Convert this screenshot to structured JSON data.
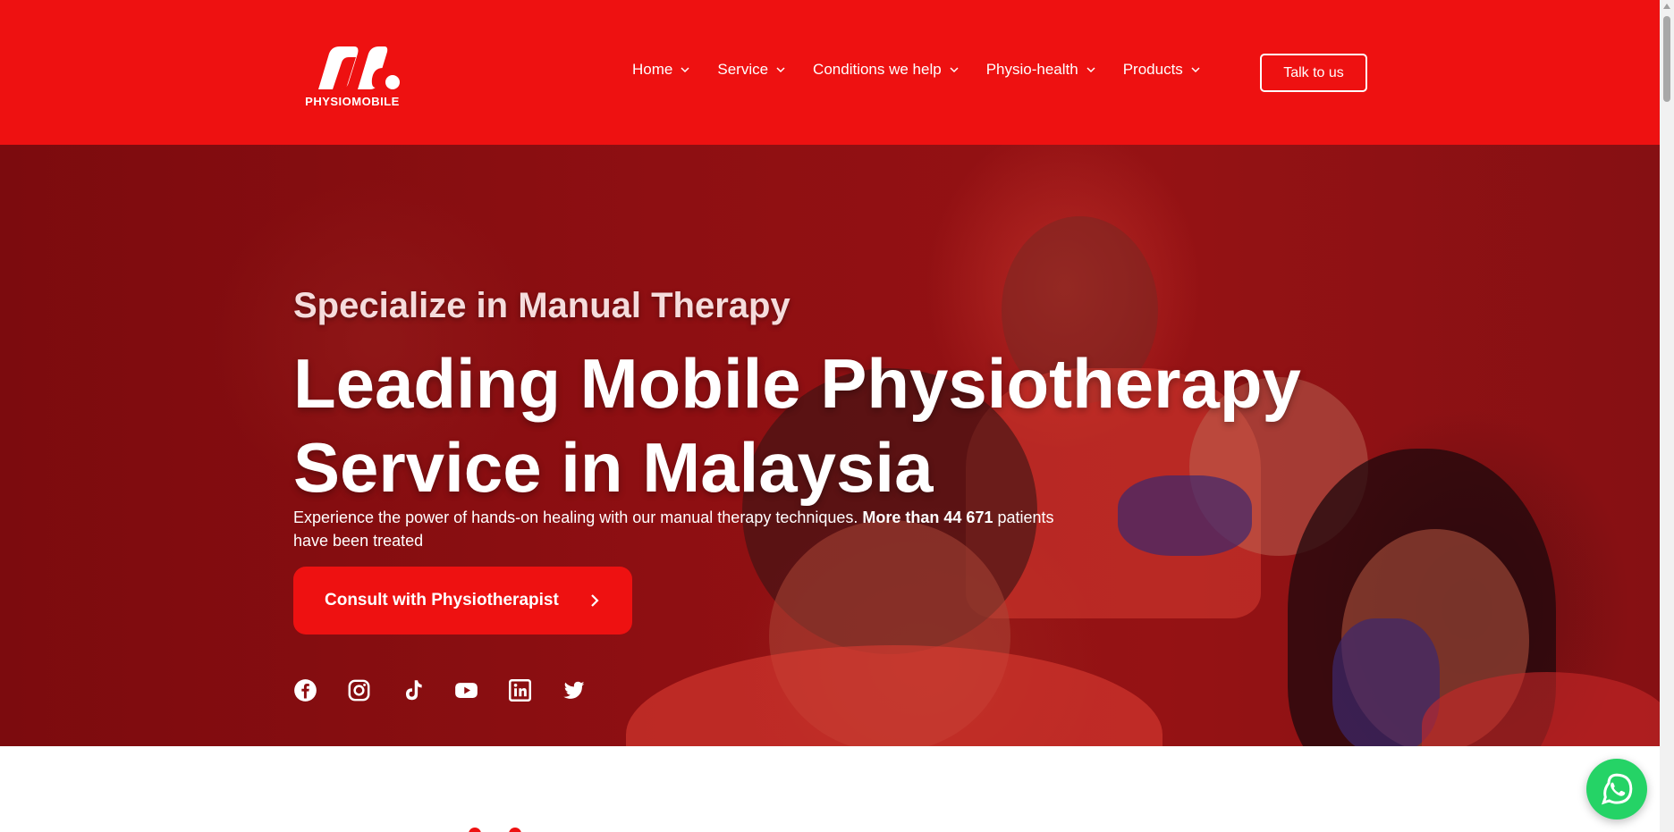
{
  "brand": {
    "name": "PHYSIOMOBILE",
    "color": "#ee1111"
  },
  "nav": {
    "items": [
      {
        "label": "Home"
      },
      {
        "label": "Service"
      },
      {
        "label": "Conditions we help"
      },
      {
        "label": "Physio-health"
      },
      {
        "label": "Products"
      }
    ],
    "cta_label": "Talk to us"
  },
  "hero": {
    "subtitle": "Specialize in Manual Therapy",
    "title": "Leading Mobile Physiotherapy Service in Malaysia",
    "description_text": "Experience the power of hands-on healing with our manual therapy techniques. ",
    "description_bold": "More than 44 671",
    "description_tail": " patients have been treated",
    "cta_label": "Consult with Physiotherapist",
    "socials": [
      "facebook-icon",
      "instagram-icon",
      "tiktok-icon",
      "youtube-icon",
      "linkedin-icon",
      "twitter-icon"
    ]
  },
  "floating": {
    "whatsapp_icon": "whatsapp-icon",
    "whatsapp_color": "#25d366"
  }
}
